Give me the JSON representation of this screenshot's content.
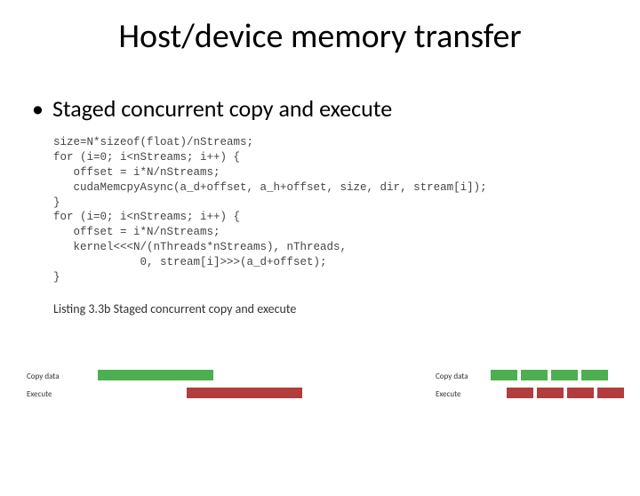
{
  "title": "Host/device memory transfer",
  "bullet": "Staged concurrent copy and execute",
  "code": "size=N*sizeof(float)/nStreams;\nfor (i=0; i<nStreams; i++) {\n   offset = i*N/nStreams;\n   cudaMemcpyAsync(a_d+offset, a_h+offset, size, dir, stream[i]);\n}\nfor (i=0; i<nStreams; i++) {\n   offset = i*N/nStreams;\n   kernel<<<N/(nThreads*nStreams), nThreads,\n             0, stream[i]>>>(a_d+offset);\n}",
  "listing_caption": "Listing 3.3b Staged concurrent copy and execute",
  "diagram": {
    "left": {
      "copy_label": "Copy data",
      "execute_label": "Execute"
    },
    "right": {
      "copy_label": "Copy data",
      "execute_label": "Execute"
    }
  }
}
